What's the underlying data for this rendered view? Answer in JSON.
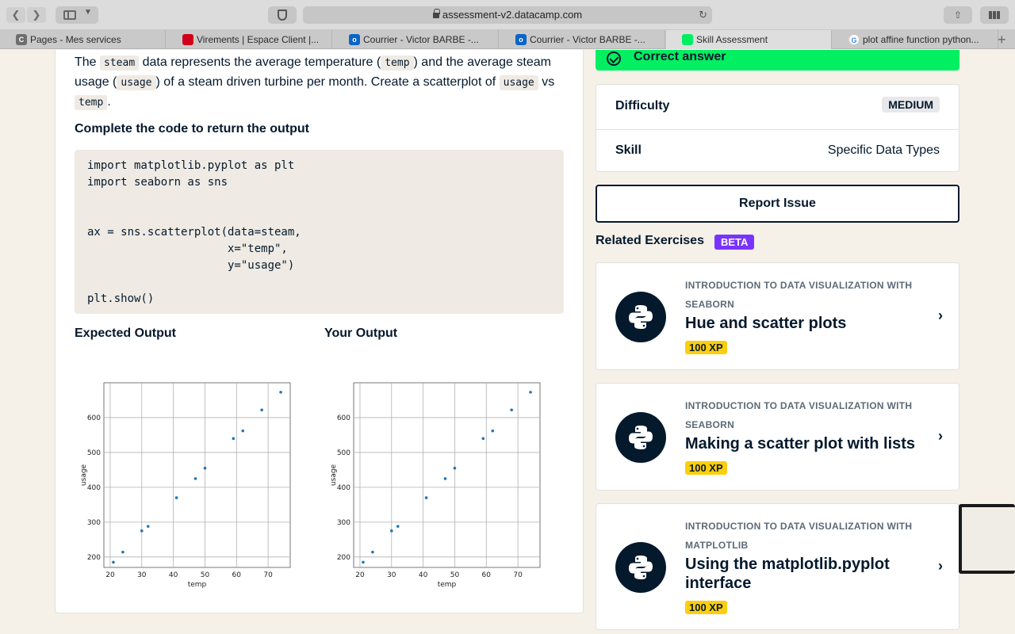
{
  "browser": {
    "url": "assessment-v2.datacamp.com",
    "tabs": [
      {
        "label": "Pages - Mes services",
        "fav": "C",
        "color": "#6e6e6e"
      },
      {
        "label": "Virements | Espace Client |...",
        "fav": "",
        "color": "#d0021b"
      },
      {
        "label": "Courrier - Victor BARBE -...",
        "fav": "o",
        "color": "#0a64c8"
      },
      {
        "label": "Courrier - Victor BARBE -...",
        "fav": "o",
        "color": "#0a64c8"
      },
      {
        "label": "Skill Assessment",
        "fav": "",
        "color": "#03ef62"
      },
      {
        "label": "plot affine function python...",
        "fav": "G",
        "color": "#ffffff"
      }
    ]
  },
  "prompt": {
    "t1": "The ",
    "c1": "steam",
    "t2": " data represents the average temperature (",
    "c2": "temp",
    "t3": ") and the average steam usage (",
    "c3": "usage",
    "t4": ") of a steam driven turbine per month. Create a scatterplot of ",
    "c4": "usage",
    "t5": " vs ",
    "c5": "temp",
    "t6": "."
  },
  "complete_label": "Complete the code to return the output",
  "code": "import matplotlib.pyplot as plt\nimport seaborn as sns\n\n\nax = sns.scatterplot(data=steam,\n                     x=\"temp\",\n                     y=\"usage\")\n\nplt.show()",
  "expected_label": "Expected Output",
  "your_label": "Your Output",
  "chart_data": [
    {
      "type": "scatter",
      "xlabel": "temp",
      "ylabel": "usage",
      "xticks": [
        20,
        30,
        40,
        50,
        60,
        70
      ],
      "yticks": [
        200,
        300,
        400,
        500,
        600
      ],
      "xlim": [
        18,
        77
      ],
      "ylim": [
        170,
        700
      ],
      "grid": true,
      "color": "#1f77b4",
      "x": [
        21,
        24,
        30,
        32,
        41,
        47,
        50,
        59,
        62,
        68,
        74
      ],
      "y": [
        185,
        214,
        275,
        288,
        370,
        425,
        455,
        540,
        562,
        622,
        673
      ]
    },
    {
      "type": "scatter",
      "xlabel": "temp",
      "ylabel": "usage",
      "xticks": [
        20,
        30,
        40,
        50,
        60,
        70
      ],
      "yticks": [
        200,
        300,
        400,
        500,
        600
      ],
      "xlim": [
        18,
        77
      ],
      "ylim": [
        170,
        700
      ],
      "grid": true,
      "color": "#1f77b4",
      "x": [
        21,
        24,
        30,
        32,
        41,
        47,
        50,
        59,
        62,
        68,
        74
      ],
      "y": [
        185,
        214,
        275,
        288,
        370,
        425,
        455,
        540,
        562,
        622,
        673
      ]
    }
  ],
  "result": {
    "text": "Correct answer",
    "color": "#03ef62"
  },
  "info": {
    "difficulty_label": "Difficulty",
    "difficulty_value": "MEDIUM",
    "skill_label": "Skill",
    "skill_value": "Specific Data Types"
  },
  "report_label": "Report Issue",
  "related": {
    "title": "Related Exercises",
    "badge": "BETA",
    "items": [
      {
        "course": "INTRODUCTION TO DATA VISUALIZATION WITH SEABORN",
        "title": "Hue and scatter plots",
        "xp": "100 XP"
      },
      {
        "course": "INTRODUCTION TO DATA VISUALIZATION WITH SEABORN",
        "title": "Making a scatter plot with lists",
        "xp": "100 XP"
      },
      {
        "course": "INTRODUCTION TO DATA VISUALIZATION WITH MATPLOTLIB",
        "title": "Using the matplotlib.pyplot interface",
        "xp": "100 XP"
      }
    ]
  }
}
